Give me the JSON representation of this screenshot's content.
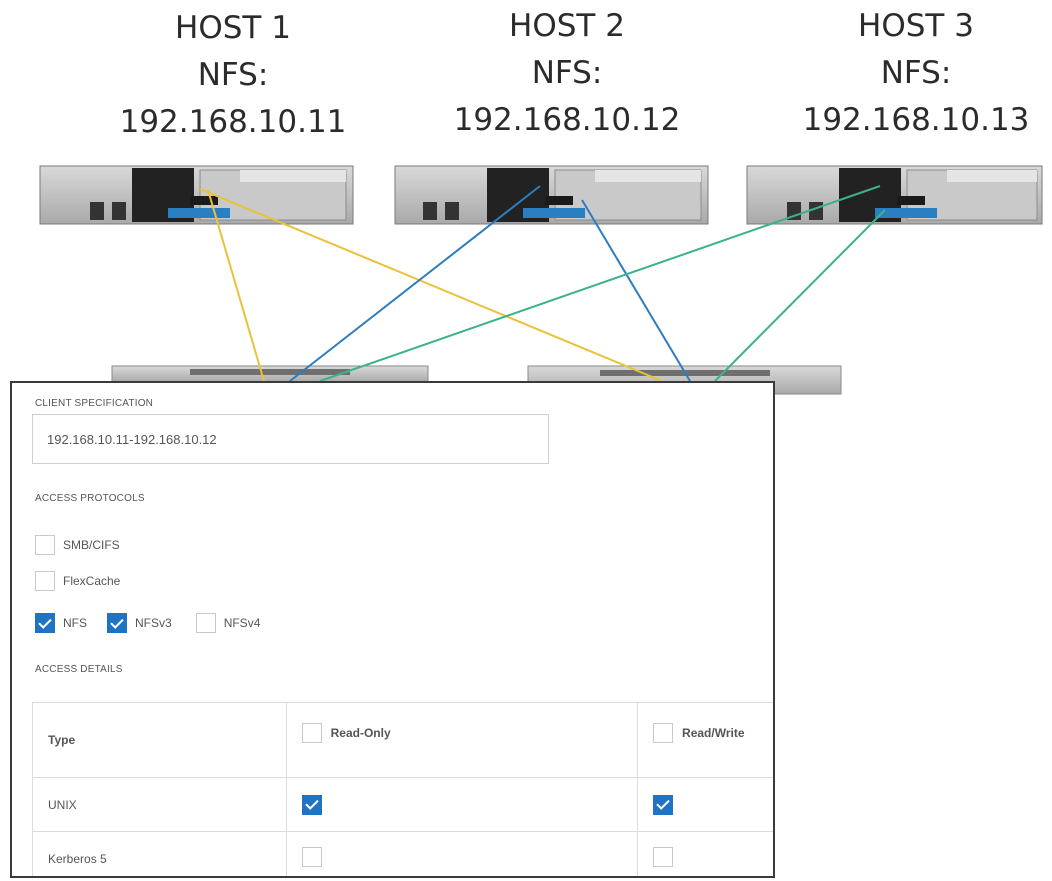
{
  "hosts": [
    {
      "name": "HOST 1",
      "proto": "NFS:",
      "ip": "192.168.10.11"
    },
    {
      "name": "HOST 2",
      "proto": "NFS:",
      "ip": "192.168.10.12"
    },
    {
      "name": "HOST 3",
      "proto": "NFS:",
      "ip": "192.168.10.13"
    }
  ],
  "cable_colors": {
    "host1": "#e9c23a",
    "host2": "#2e7cc0",
    "host3": "#3bb28a"
  },
  "client_specification": {
    "title": "CLIENT SPECIFICATION",
    "value": "192.168.10.11-192.168.10.12"
  },
  "access_protocols": {
    "title": "ACCESS PROTOCOLS",
    "smb": {
      "label": "SMB/CIFS",
      "checked": false
    },
    "flexcache": {
      "label": "FlexCache",
      "checked": false
    },
    "nfs": {
      "label": "NFS",
      "checked": true
    },
    "nfsv3": {
      "label": "NFSv3",
      "checked": true
    },
    "nfsv4": {
      "label": "NFSv4",
      "checked": false
    }
  },
  "access_details": {
    "title": "ACCESS DETAILS",
    "columns": {
      "type": "Type",
      "read_only": "Read-Only",
      "read_write": "Read/Write"
    },
    "rows": [
      {
        "type": "UNIX",
        "read_only": true,
        "read_write": true
      },
      {
        "type": "Kerberos 5",
        "read_only": false,
        "read_write": false
      }
    ]
  },
  "accent_color": "#1f73c5"
}
